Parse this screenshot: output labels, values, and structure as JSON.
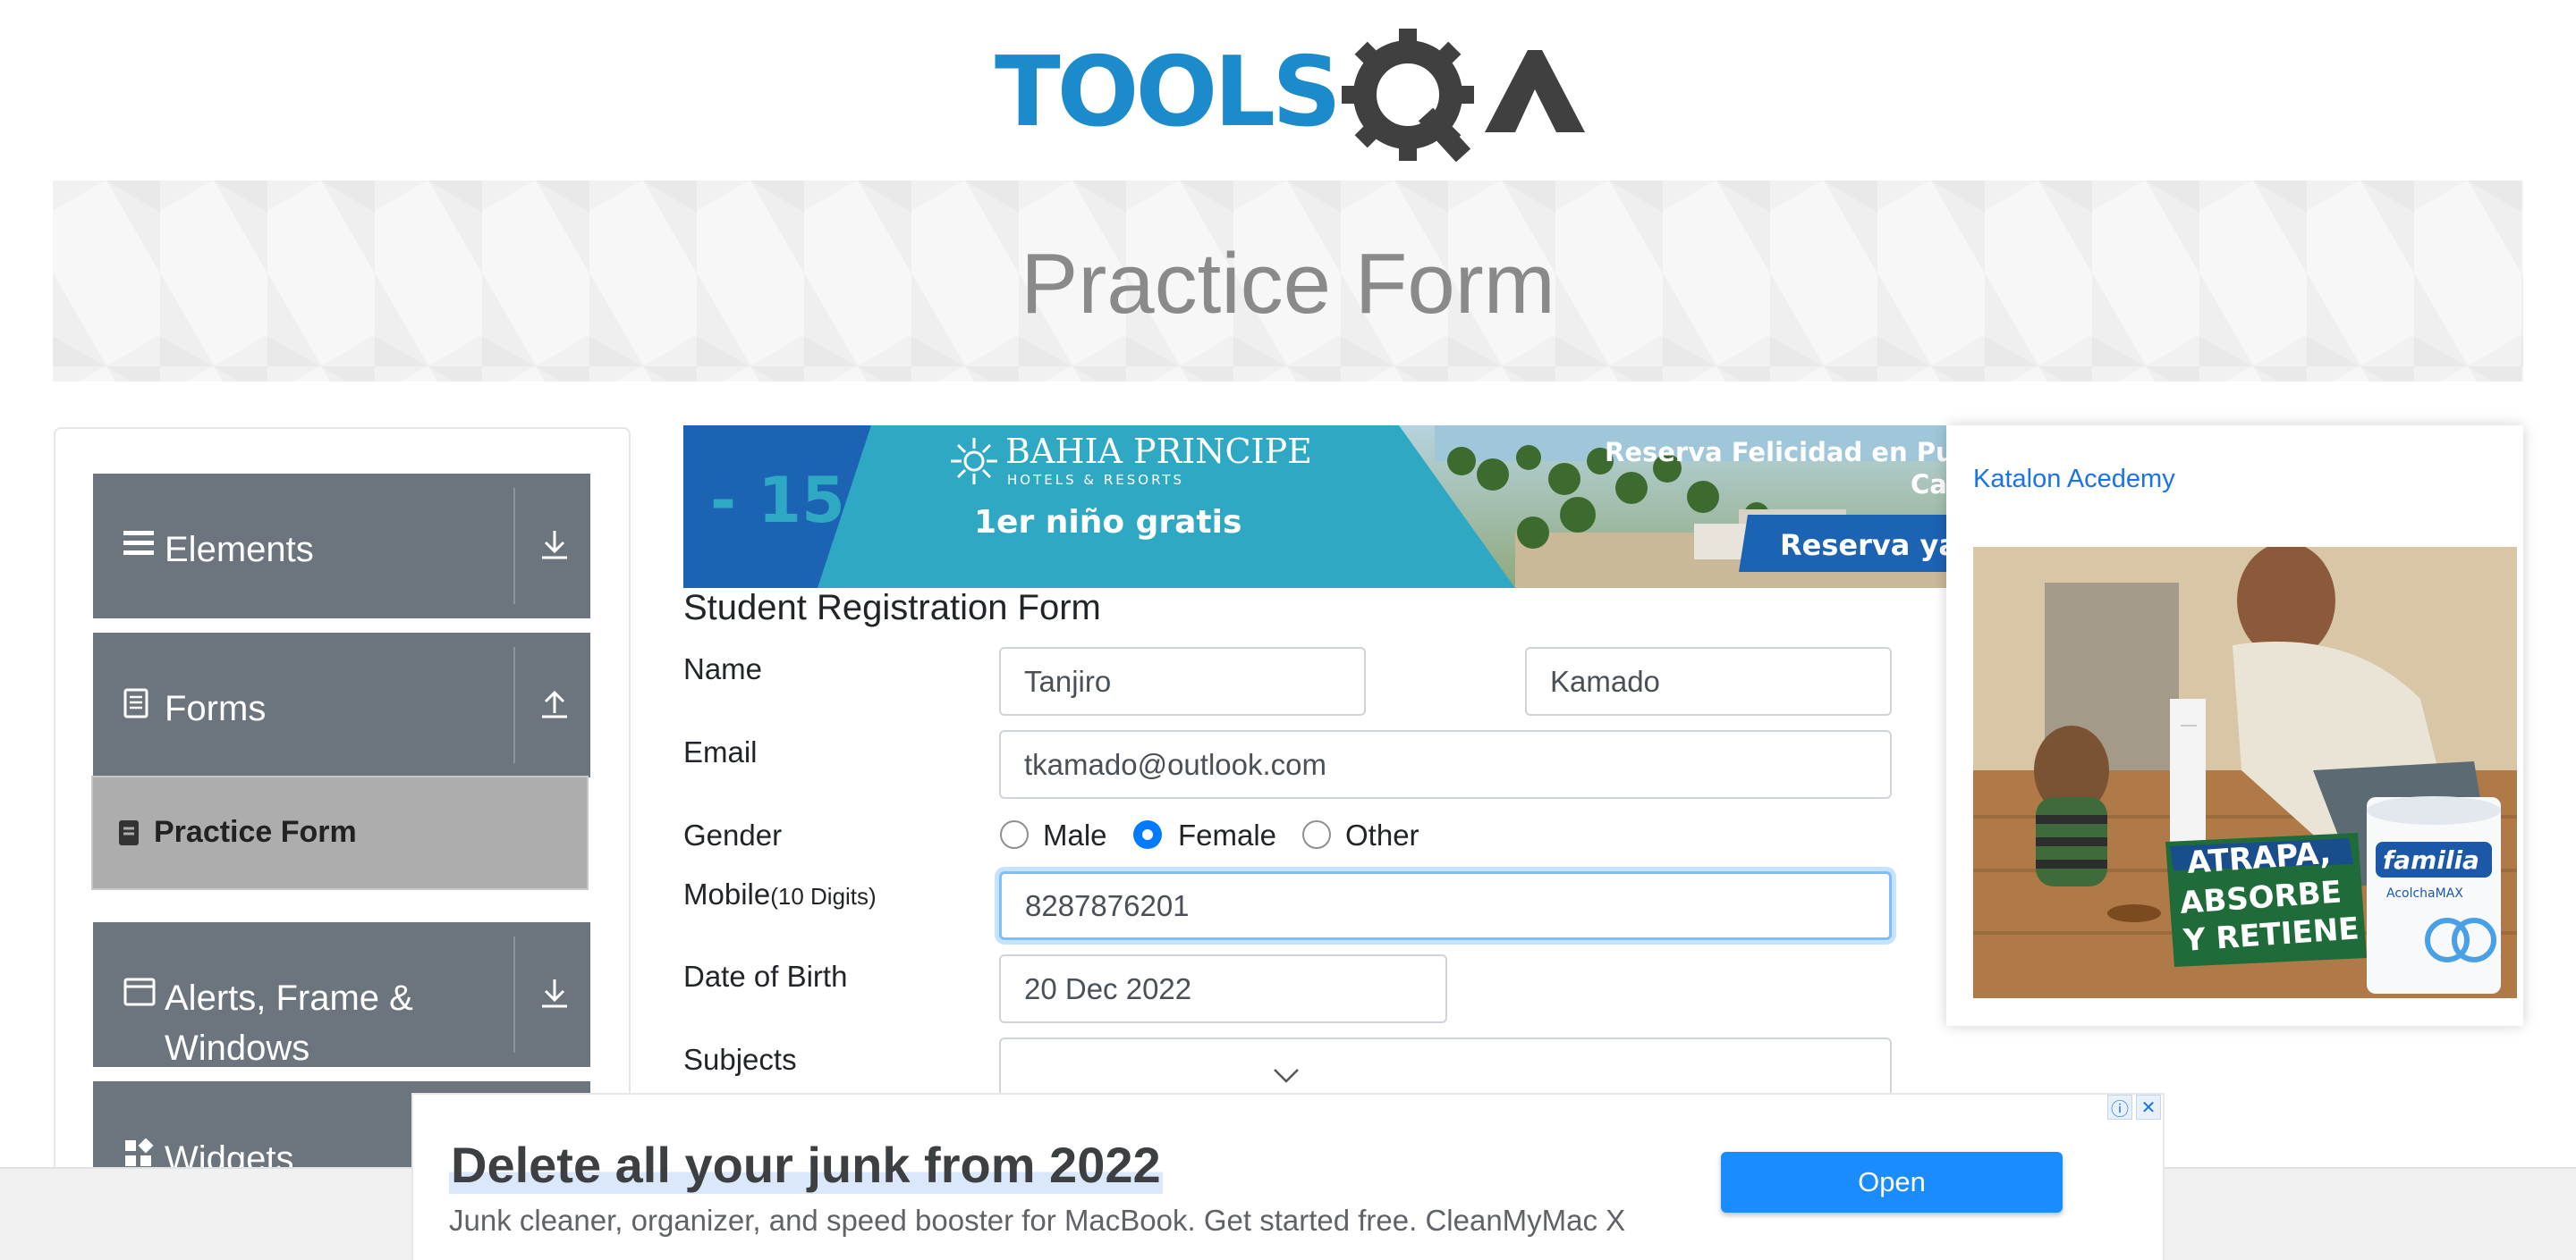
{
  "header": {
    "logo_text": "TOOLSQA"
  },
  "banner": {
    "title": "Practice Form"
  },
  "sidebar": {
    "groups": [
      {
        "label": "Elements",
        "icon": "hamburger-icon",
        "arrow": "download-arrow-icon"
      },
      {
        "label": "Forms",
        "icon": "document-icon",
        "arrow": "upload-arrow-icon"
      },
      {
        "label": "Alerts, Frame &",
        "label2": "Windows",
        "icon": "window-icon",
        "arrow": "download-arrow-icon"
      },
      {
        "label": "Widgets",
        "icon": "widgets-icon"
      }
    ],
    "active_item": {
      "label": "Practice Form",
      "icon": "form-icon"
    }
  },
  "travel_ad": {
    "discount": "- 15 %",
    "brand": "BAHIA PRINCIPE",
    "brand_sub": "HOTELS & RESORTS",
    "offer": "1er niño gratis",
    "tagline": "Reserva Felicidad en Pur",
    "tagline2": "Ca",
    "cta": "Reserva ya"
  },
  "form": {
    "title": "Student Registration Form",
    "name_label": "Name",
    "first_name": "Tanjiro",
    "last_name": "Kamado",
    "email_label": "Email",
    "email": "tkamado@outlook.com",
    "gender_label": "Gender",
    "gender_options": [
      "Male",
      "Female",
      "Other"
    ],
    "gender_selected": "Female",
    "mobile_label": "Mobile",
    "mobile_hint": "(10 Digits)",
    "mobile": "8287876201",
    "dob_label": "Date of Birth",
    "dob": "20 Dec 2022",
    "subjects_label": "Subjects"
  },
  "right_ad": {
    "link": "Katalon Acedemy",
    "slogan_lines": [
      "ATRAPA,",
      "ABSORBE",
      "Y RETIENE"
    ],
    "brand": "familia",
    "product": "AcolchaMAX"
  },
  "bottom_ad": {
    "headline": "Delete all your junk from 2022",
    "body": "Junk cleaner, organizer, and speed booster for MacBook. Get started free. CleanMyMac X",
    "cta": "Open",
    "info_icon": "ⓘ",
    "close_icon": "✕"
  },
  "colors": {
    "sidebar_group": "#6c757d",
    "active_item": "#adadad",
    "primary": "#007bff",
    "logo_blue": "#1c8bcb"
  }
}
